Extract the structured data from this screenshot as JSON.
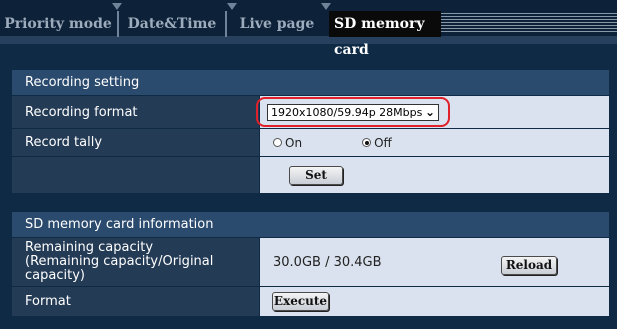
{
  "tabs": [
    {
      "label": "Priority mode"
    },
    {
      "label": "Date&Time"
    },
    {
      "label": "Live page"
    },
    {
      "label": "SD memory card",
      "active": true
    }
  ],
  "recording_setting": {
    "heading": "Recording setting",
    "format_label": "Recording format",
    "format_value": "1920x1080/59.94p 28Mbps",
    "tally_label": "Record tally",
    "tally_options": [
      "On",
      "Off"
    ],
    "tally_selected": "Off",
    "set_button": "Set"
  },
  "sd_info": {
    "heading": "SD memory card information",
    "remaining_label_line1": "Remaining capacity",
    "remaining_label_line2": "(Remaining capacity/Original capacity)",
    "remaining_value": "30.0GB / 30.4GB",
    "reload_button": "Reload",
    "format_label": "Format",
    "execute_button": "Execute"
  },
  "colors": {
    "highlight": "#e0202a",
    "header_bg": "#2a4a6e",
    "label_bg": "#243b56",
    "value_bg": "#d9e2ee"
  }
}
